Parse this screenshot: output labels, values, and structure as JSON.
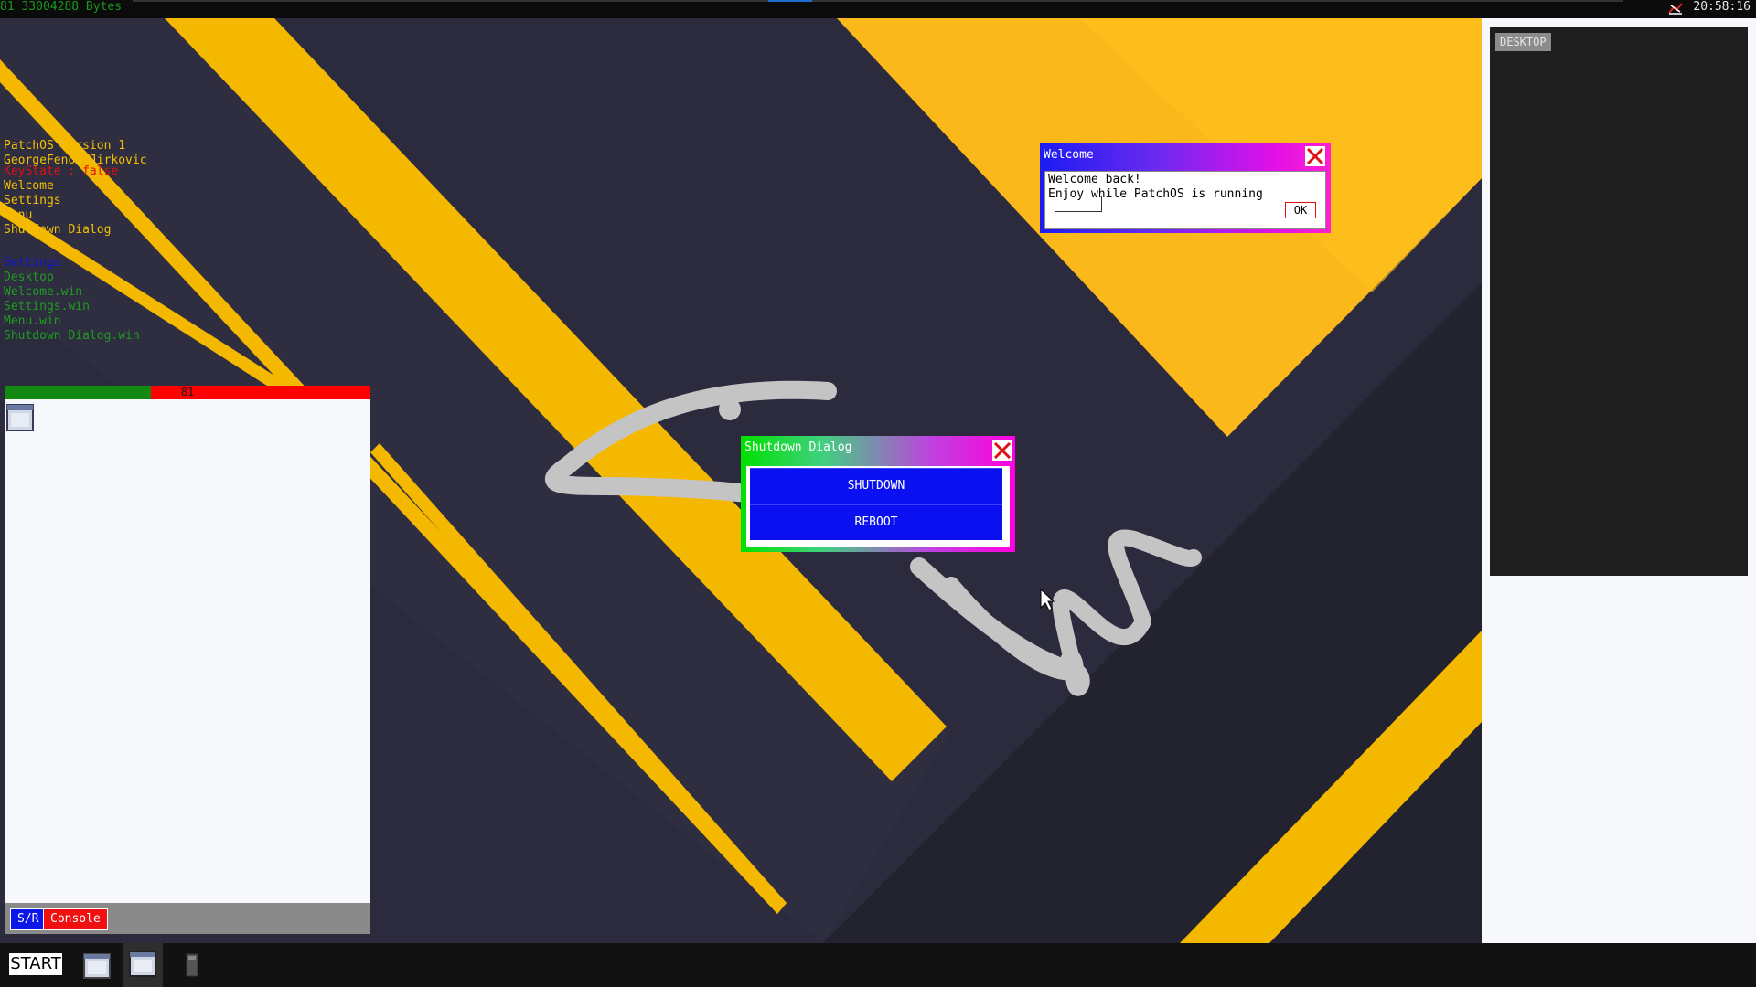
{
  "topbar": {
    "memory_readout": "81 33004288 Bytes",
    "clock": "20:58:16",
    "tray_icon": "network-status-icon"
  },
  "info": {
    "os_version": "PatchOS Version 1",
    "author": "GeorgeFenoo Jirkovic",
    "keystate": "KeyState : false",
    "programs": [
      "Welcome",
      "Settings",
      "Menu",
      "Shutdown Dialog"
    ],
    "section_label": "Settings",
    "windows": [
      "Desktop",
      "Welcome.win",
      "Settings.win",
      "Menu.win",
      "Shutdown Dialog.win"
    ]
  },
  "panel": {
    "count_label": "81",
    "progress_fraction": 0.4,
    "icon": "window-icon",
    "sr_button": "S/R",
    "console_button": "Console"
  },
  "desktop_panel": {
    "label": "DESKTOP"
  },
  "welcome": {
    "title": "Welcome",
    "line1": "Welcome back!",
    "line2": "Enjoy while PatchOS is running",
    "ok_button": "OK"
  },
  "shutdown": {
    "title": "Shutdown Dialog",
    "shutdown_button": "SHUTDOWN",
    "reboot_button": "REBOOT"
  },
  "taskbar": {
    "start_button": "START",
    "items": [
      "window-icon",
      "window-icon",
      "terminal-icon"
    ]
  },
  "colors": {
    "wallpaper_dark": "#2a2a3c",
    "wallpaper_yellow": "#f5b800",
    "accent_blue": "#0a10f0",
    "accent_red": "#f01010",
    "accent_green": "#128a12"
  }
}
